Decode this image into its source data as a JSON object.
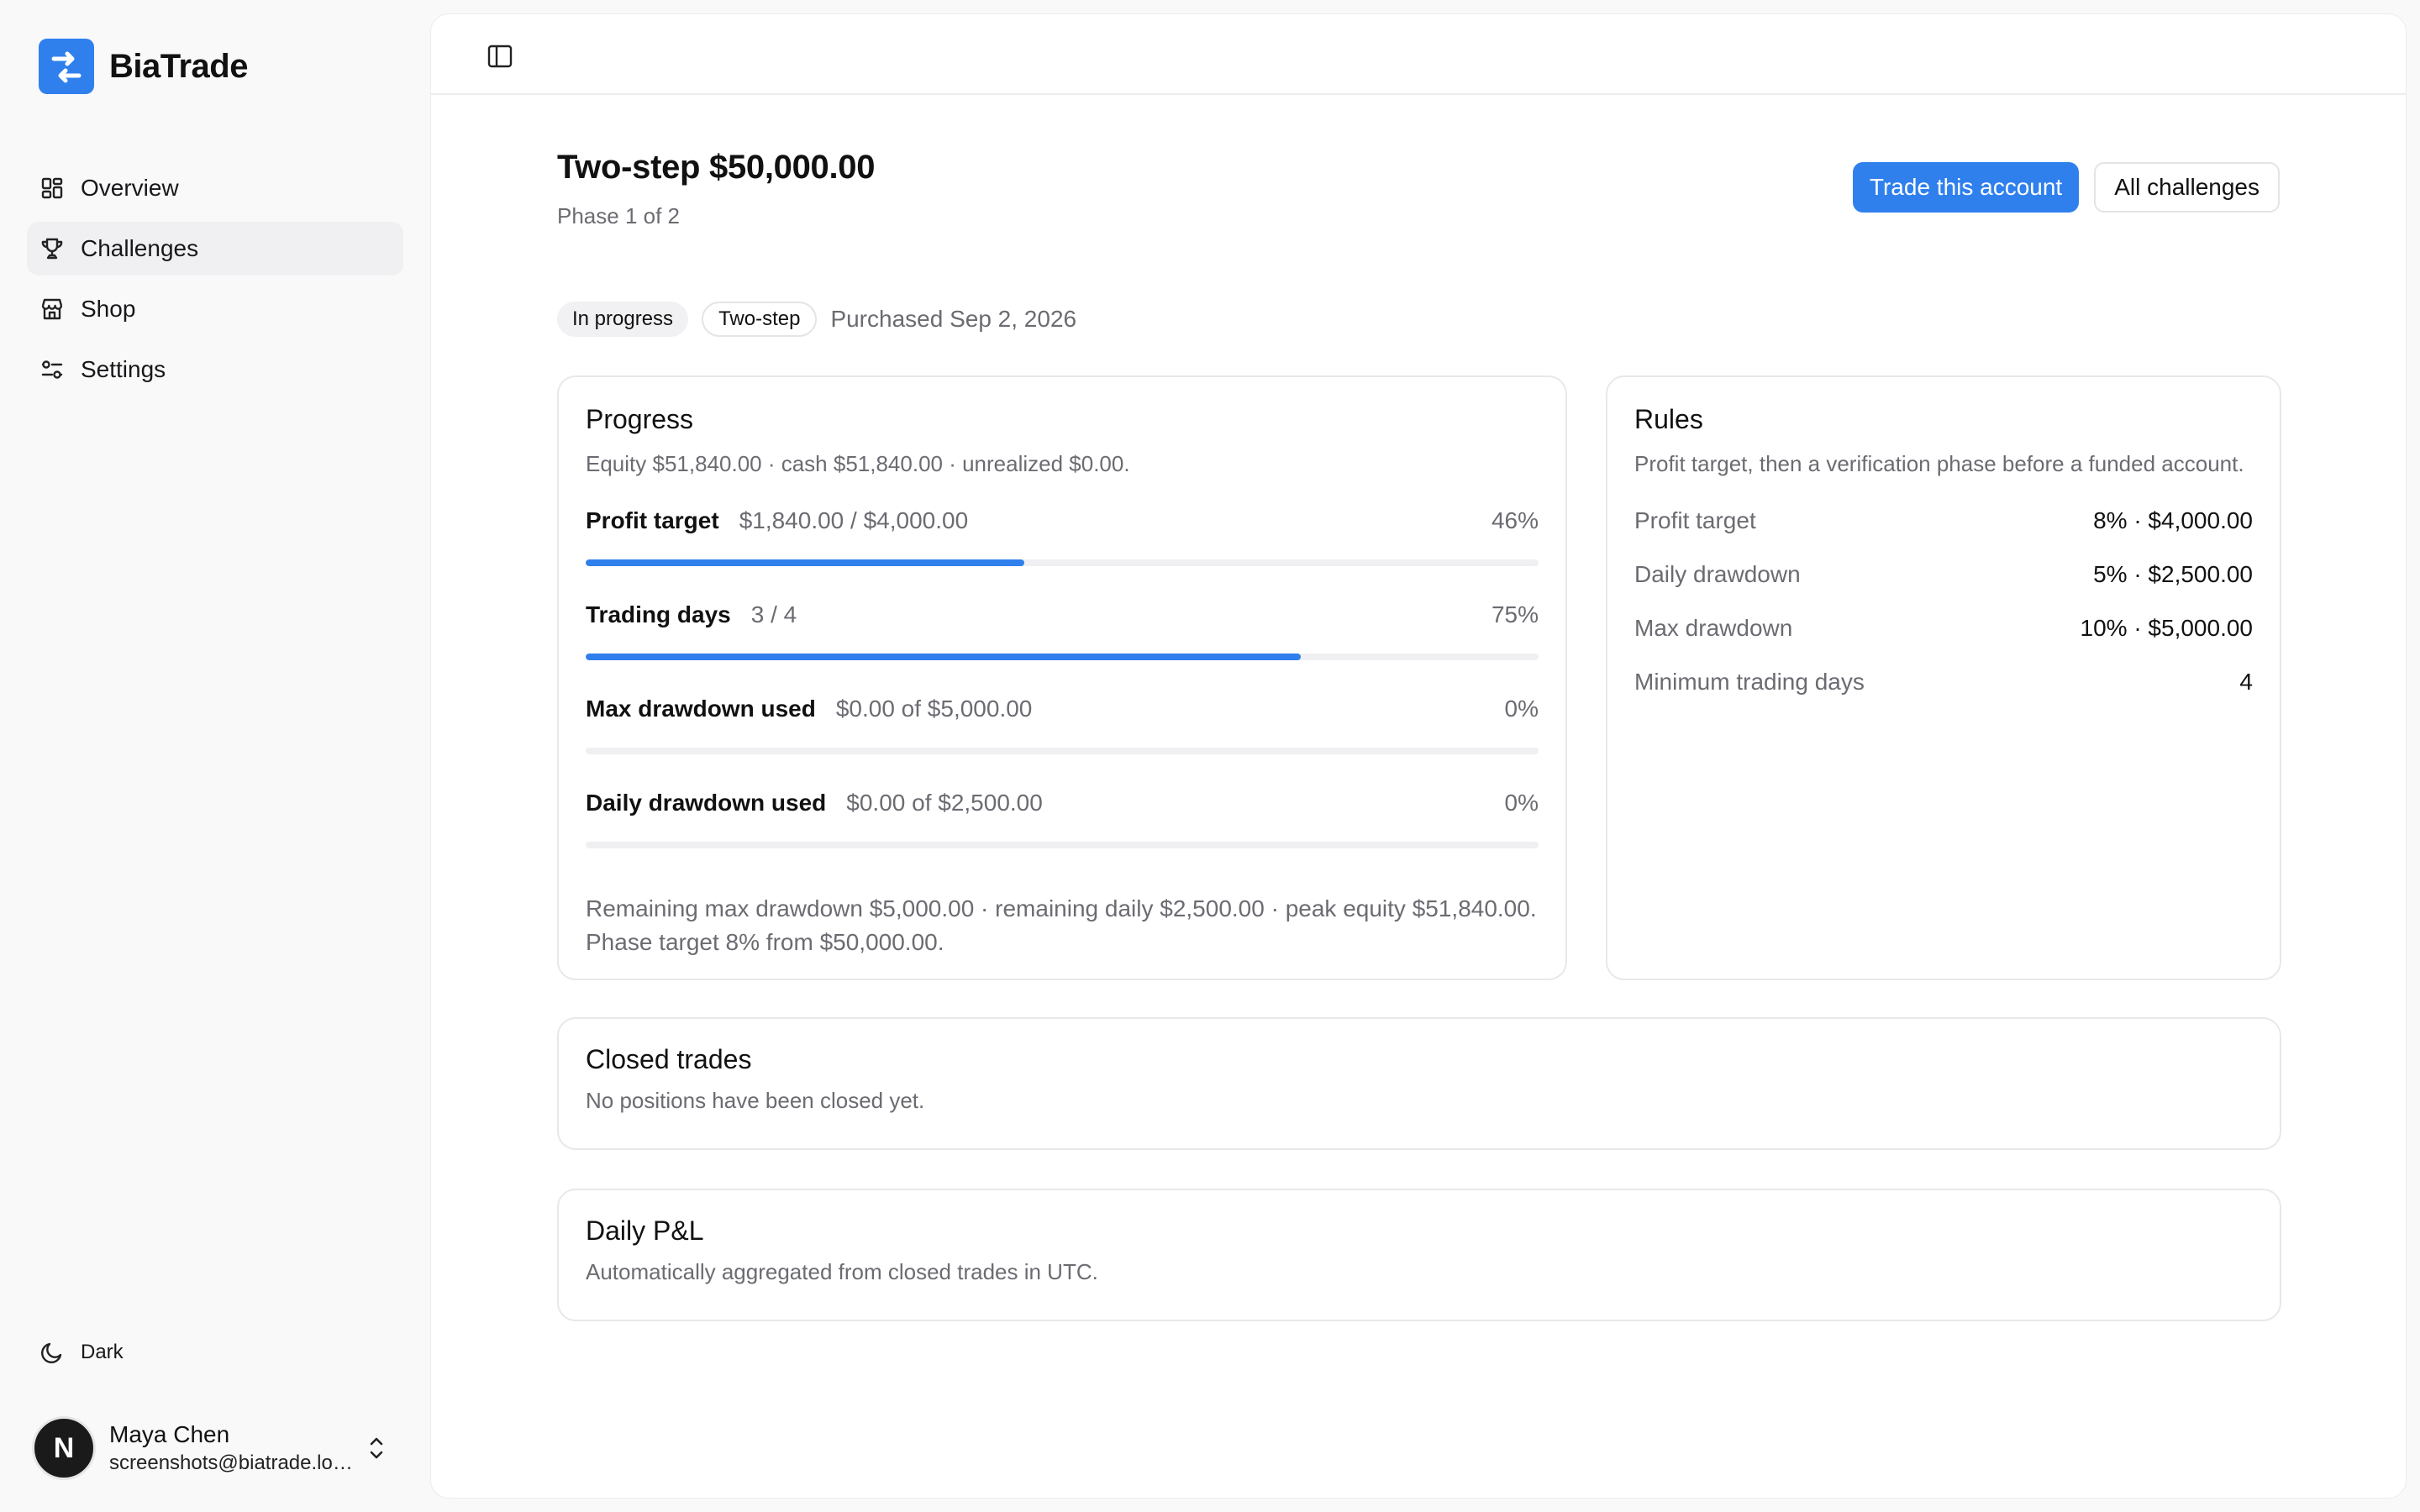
{
  "brand": {
    "name": "BiaTrade",
    "accent": "#2f80ed"
  },
  "sidebar": {
    "items": [
      {
        "label": "Overview",
        "icon": "dashboard-icon",
        "active": false
      },
      {
        "label": "Challenges",
        "icon": "trophy-icon",
        "active": true
      },
      {
        "label": "Shop",
        "icon": "store-icon",
        "active": false
      },
      {
        "label": "Settings",
        "icon": "sliders-icon",
        "active": false
      }
    ],
    "theme_toggle": {
      "label": "Dark",
      "icon": "moon-icon"
    },
    "user": {
      "name": "Maya Chen",
      "email": "screenshots@biatrade.local",
      "avatar_initial": "N"
    }
  },
  "header": {
    "title": "Two-step $50,000.00",
    "subtitle": "Phase 1 of 2",
    "primary_action": "Trade this account",
    "secondary_action": "All challenges"
  },
  "tags": {
    "status": "In progress",
    "type": "Two-step",
    "purchased": "Purchased Sep 2, 2026"
  },
  "progress": {
    "title": "Progress",
    "summary": "Equity $51,840.00 · cash $51,840.00 · unrealized $0.00.",
    "metrics": [
      {
        "label": "Profit target",
        "value": "$1,840.00 / $4,000.00",
        "pct": "46%",
        "fraction": 0.46
      },
      {
        "label": "Trading days",
        "value": "3 / 4",
        "pct": "75%",
        "fraction": 0.75
      },
      {
        "label": "Max drawdown used",
        "value": "$0.00 of $5,000.00",
        "pct": "0%",
        "fraction": 0
      },
      {
        "label": "Daily drawdown used",
        "value": "$0.00 of $2,500.00",
        "pct": "0%",
        "fraction": 0
      }
    ],
    "footer": "Remaining max drawdown $5,000.00 · remaining daily $2,500.00 · peak equity $51,840.00. Phase target 8% from $50,000.00."
  },
  "rules": {
    "title": "Rules",
    "description": "Profit target, then a verification phase before a funded account.",
    "items": [
      {
        "label": "Profit target",
        "value": "8% · $4,000.00"
      },
      {
        "label": "Daily drawdown",
        "value": "5% · $2,500.00"
      },
      {
        "label": "Max drawdown",
        "value": "10% · $5,000.00"
      },
      {
        "label": "Minimum trading days",
        "value": "4"
      }
    ]
  },
  "closed_trades": {
    "title": "Closed trades",
    "description": "No positions have been closed yet."
  },
  "daily_pnl": {
    "title": "Daily P&L",
    "description": "Automatically aggregated from closed trades in UTC."
  }
}
